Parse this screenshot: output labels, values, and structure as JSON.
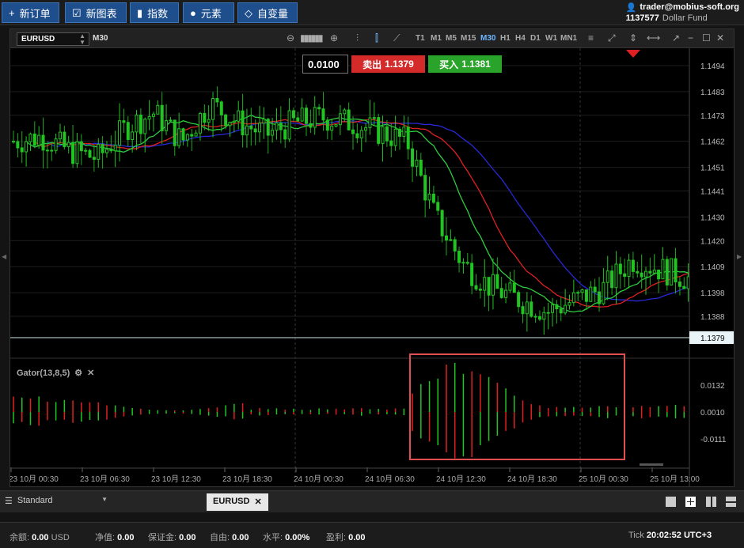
{
  "toolbar": {
    "new_order": "新订单",
    "new_chart": "新图表",
    "indicators": "指数",
    "elements": "元素",
    "variables": "自变量"
  },
  "account": {
    "user": "trader@mobius-soft.org",
    "number": "1137577",
    "fund": "Dollar Fund"
  },
  "chart": {
    "symbol": "EURUSD",
    "timeframe": "M30",
    "timeframes": [
      "T1",
      "M1",
      "M5",
      "M15",
      "M30",
      "H1",
      "H4",
      "D1",
      "W1",
      "MN1"
    ],
    "active_timeframe": "M30",
    "lot": "0.0100",
    "sell_label": "卖出",
    "sell_price": "1.1379",
    "buy_label": "买入",
    "buy_price": "1.1381",
    "current_price": "1.1379",
    "price_ticks": [
      "1.1494",
      "1.1483",
      "1.1473",
      "1.1462",
      "1.1451",
      "1.1441",
      "1.1430",
      "1.1420",
      "1.1409",
      "1.1398",
      "1.1388"
    ],
    "indicator_name": "Gator(13,8,5)",
    "gator_ticks": [
      "0.0132",
      "0.0010",
      "-0.0111"
    ],
    "time_ticks": [
      "23 10月 00:30",
      "23 10月 06:30",
      "23 10月 12:30",
      "23 10月 18:30",
      "24 10月 00:30",
      "24 10月 06:30",
      "24 10月 12:30",
      "24 10月 18:30",
      "25 10月 00:30",
      "25 10月 13:00"
    ],
    "colors": {
      "up": "#22c422",
      "down": "#e02020",
      "ma_blue": "#2828d8",
      "ma_red": "#e02020",
      "ma_green": "#2ecc40",
      "highlight": "#e05050"
    }
  },
  "chart_data": {
    "type": "candlestick",
    "title": "EURUSD M30",
    "ylim": [
      1.1383,
      1.15
    ],
    "x": [
      "23 10月 00:30",
      "23 10月 06:30",
      "23 10月 12:30",
      "23 10月 18:30",
      "24 10月 00:30",
      "24 10月 06:30",
      "24 10月 12:30",
      "24 10月 18:30",
      "25 10月 00:30",
      "25 10月 13:00"
    ],
    "close_path": [
      1.1462,
      1.1464,
      1.1458,
      1.1455,
      1.1468,
      1.1474,
      1.1462,
      1.1478,
      1.147,
      1.1465,
      1.147,
      1.1472,
      1.147,
      1.1466,
      1.1462,
      1.143,
      1.141,
      1.14,
      1.1395,
      1.139,
      1.1395,
      1.14,
      1.1412,
      1.1408,
      1.1404
    ],
    "last_price": 1.1379,
    "indicator": {
      "name": "Gator(13,8,5)",
      "ticks": [
        0.0132,
        0.001,
        -0.0111
      ]
    }
  },
  "tabs": {
    "layout": "Standard",
    "active": "EURUSD"
  },
  "status": {
    "balance_label": "余额:",
    "balance": "0.00",
    "currency": "USD",
    "equity_label": "净值:",
    "equity": "0.00",
    "margin_label": "保证金:",
    "margin": "0.00",
    "free_label": "自由:",
    "free": "0.00",
    "level_label": "水平:",
    "level": "0.00%",
    "profit_label": "盈利:",
    "profit": "0.00",
    "tick_label": "Tick",
    "time": "20:02:52",
    "tz": "UTC+3"
  }
}
